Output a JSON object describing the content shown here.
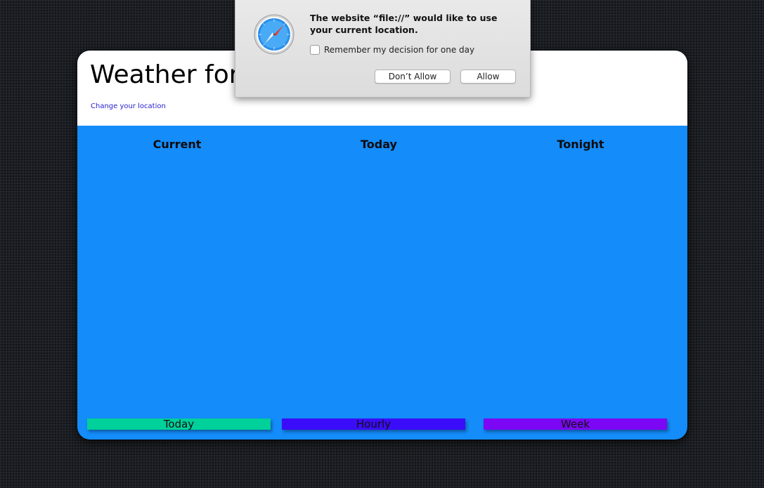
{
  "header": {
    "title": "Weather for",
    "change_location_link": "Change your location"
  },
  "columns": [
    {
      "heading": "Current"
    },
    {
      "heading": "Today"
    },
    {
      "heading": "Tonight"
    }
  ],
  "tabs": [
    {
      "label": "Today",
      "color": "#00d09a"
    },
    {
      "label": "Hourly",
      "color": "#3b0cf9"
    },
    {
      "label": "Week",
      "color": "#7b07f5"
    }
  ],
  "colors": {
    "main_background": "#148cfa",
    "header_background": "#ffffff",
    "link": "#2a22cf"
  },
  "permission_dialog": {
    "icon": "safari-compass-icon",
    "message": "The website “file://” would like to use your current location.",
    "remember_label": "Remember my decision for one day",
    "remember_checked": false,
    "dont_allow_label": "Don’t Allow",
    "allow_label": "Allow"
  }
}
